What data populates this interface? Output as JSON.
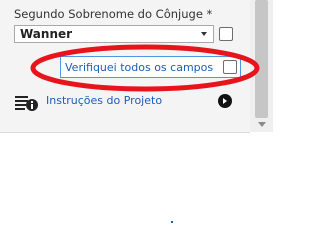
{
  "spouse_second_surname": {
    "label": "Segundo Sobrenome do Cônjuge *",
    "selected_value": "Wanner"
  },
  "verification": {
    "label": "Verifiquei todos os campos",
    "checked": false
  },
  "project_instructions": {
    "link_text": "Instruções do Projeto",
    "icon": "document-info-icon"
  },
  "colors": {
    "link": "#1a5fb4",
    "highlight": "#e8141c",
    "focus_border": "#4f97e6",
    "panel_background": "#f4f4f4"
  }
}
